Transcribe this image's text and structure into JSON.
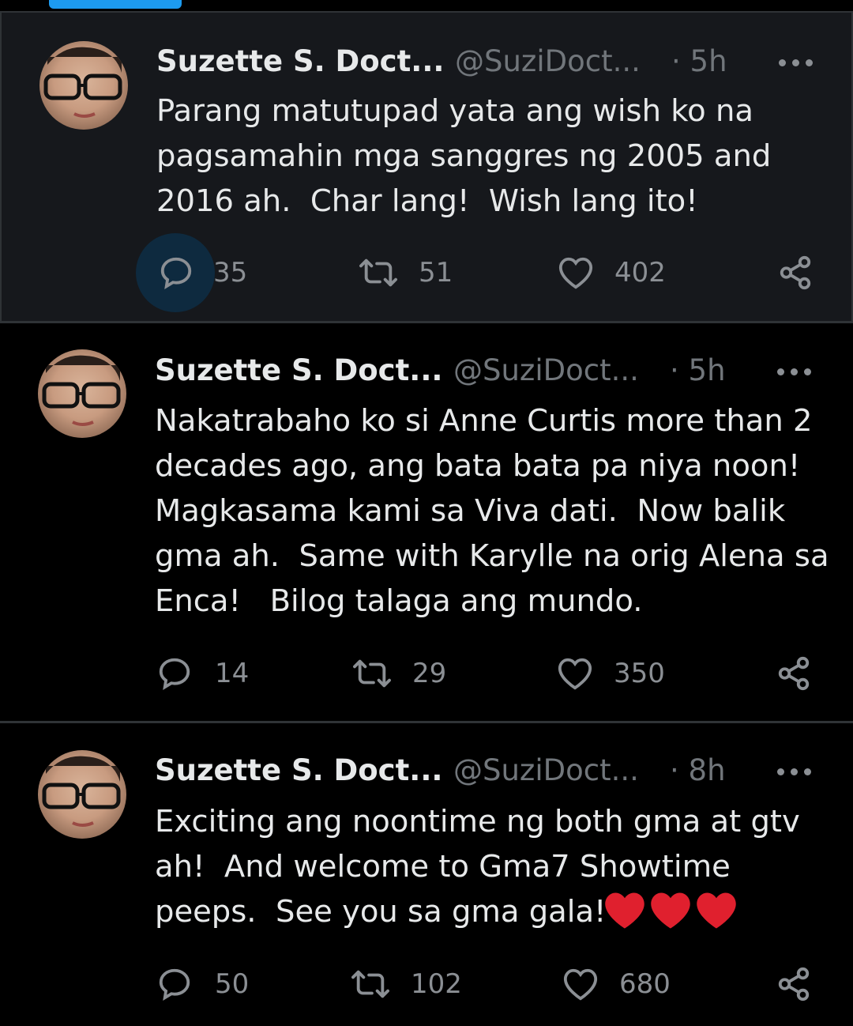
{
  "accent": "#1d9bf0",
  "tweets": [
    {
      "name": "Suzette S. Doct...",
      "handle": "@SuziDoct...",
      "time": "· 5h",
      "text": "Parang matutupad yata ang wish ko na\npagsamahin mga sanggres ng 2005 and\n2016 ah.  Char lang!  Wish lang ito!",
      "replies": "35",
      "retweets": "51",
      "likes": "402"
    },
    {
      "name": "Suzette S. Doct...",
      "handle": "@SuziDoct...",
      "time": "· 5h",
      "text": "Nakatrabaho ko si Anne Curtis more than 2\ndecades ago, ang bata bata pa niya noon!\nMagkasama kami sa Viva dati.  Now balik\ngma ah.  Same with Karylle na orig Alena sa\nEnca!   Bilog talaga ang mundo.",
      "replies": "14",
      "retweets": "29",
      "likes": "350"
    },
    {
      "name": "Suzette S. Doct...",
      "handle": "@SuziDoct...",
      "time": "· 8h",
      "text": "Exciting ang noontime ng both gma at gtv\nah!  And welcome to Gma7 Showtime\npeeps.  See you sa gma gala!",
      "replies": "50",
      "retweets": "102",
      "likes": "680"
    }
  ],
  "icons": {
    "reply": "reply-icon",
    "retweet": "retweet-icon",
    "like": "heart-icon",
    "share": "share-icon",
    "more": "more-icon",
    "emoji": "red-heart-emoji"
  },
  "colors": {
    "background": "#000000",
    "highlight_bg": "#16181c",
    "text": "#e7e9ea",
    "muted": "#71767b",
    "emoji_red": "#e0202e"
  }
}
